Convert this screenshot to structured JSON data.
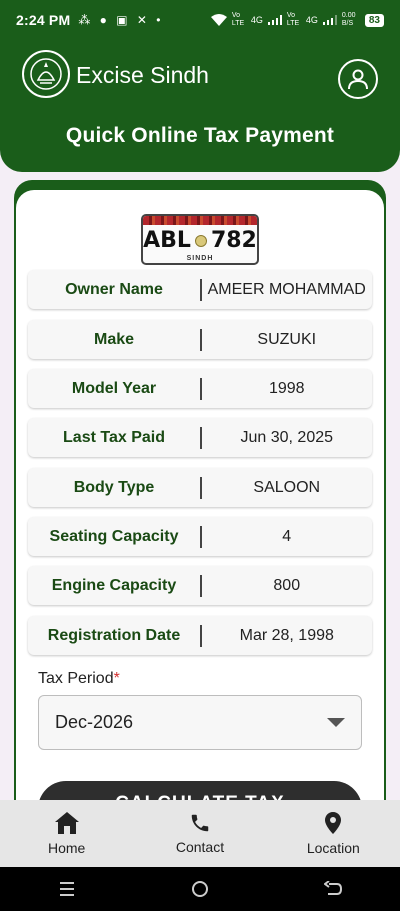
{
  "status_bar": {
    "time": "2:24 PM",
    "notification_icons": "⁂ ● ▣ ✕ •",
    "net_label_1": "Vo LTE",
    "net_label_2": "4G",
    "net_label_3": "Vo LTE",
    "net_label_4": "4G",
    "speed": "0.00 B/S",
    "battery": "83"
  },
  "header": {
    "app_title": "Excise Sindh",
    "page_title": "Quick Online Tax Payment"
  },
  "plate": {
    "letters": "ABL",
    "number": "782",
    "province": "SINDH"
  },
  "details": [
    {
      "label": "Owner Name",
      "value": "AMEER MOHAMMAD"
    },
    {
      "label": "Make",
      "value": "SUZUKI"
    },
    {
      "label": "Model Year",
      "value": "1998"
    },
    {
      "label": "Last Tax Paid",
      "value": "Jun 30, 2025"
    },
    {
      "label": "Body Type",
      "value": "SALOON"
    },
    {
      "label": "Seating Capacity",
      "value": "4"
    },
    {
      "label": "Engine Capacity",
      "value": "800"
    },
    {
      "label": "Registration Date",
      "value": "Mar 28, 1998"
    }
  ],
  "tax_period": {
    "label": "Tax Period",
    "required_mark": "*",
    "selected": "Dec-2026"
  },
  "calculate_button": {
    "label": "CALCULATE TAX"
  },
  "bottom_nav": [
    {
      "label": "Home",
      "icon": "home-icon"
    },
    {
      "label": "Contact",
      "icon": "phone-icon"
    },
    {
      "label": "Location",
      "icon": "location-pin-icon"
    }
  ],
  "colors": {
    "brand_green": "#1a5d1a",
    "label_green": "#1a4a14",
    "button_dark": "#2e2e2e",
    "required_red": "#d32f2f"
  }
}
